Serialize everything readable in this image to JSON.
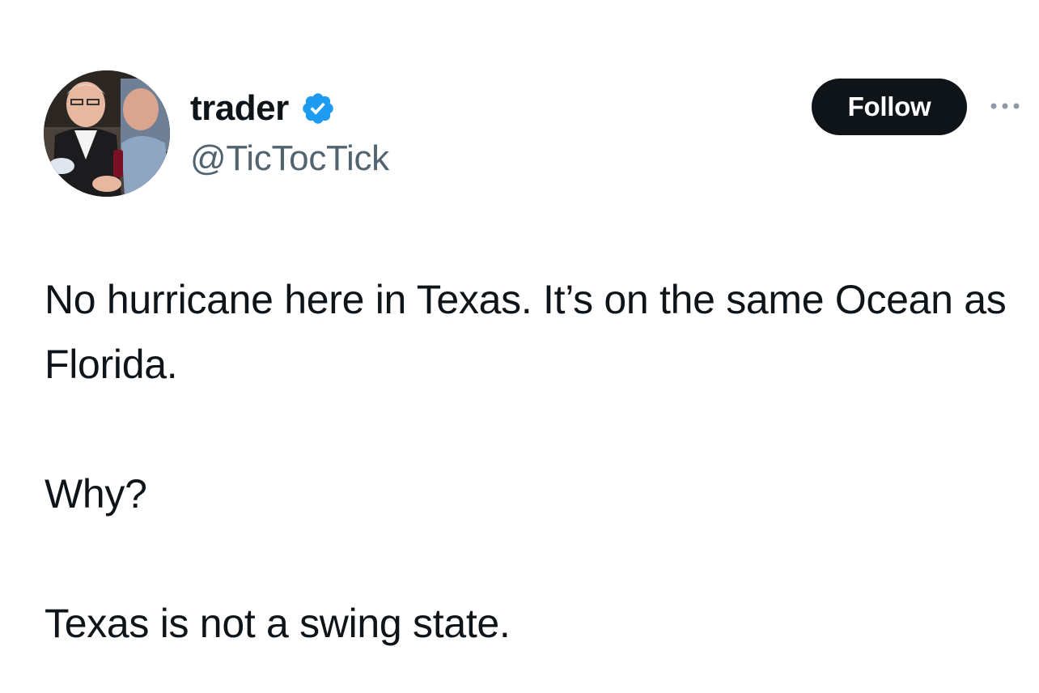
{
  "author": {
    "display_name": "trader",
    "handle": "@TicTocTick",
    "verified": true,
    "verified_badge_color": "#1d9bf0",
    "avatar_icon": "profile-photo"
  },
  "actions": {
    "follow_label": "Follow",
    "more_icon": "more-horizontal-icon"
  },
  "tweet": {
    "paragraphs": [
      "No hurricane here in Texas. It’s on the same Ocean as Florida.",
      "Why?",
      "Texas is not a swing state."
    ]
  },
  "colors": {
    "text": "#0f1419",
    "secondary_text": "#536471",
    "button_bg": "#0f1419",
    "button_text": "#ffffff",
    "background": "#ffffff"
  }
}
